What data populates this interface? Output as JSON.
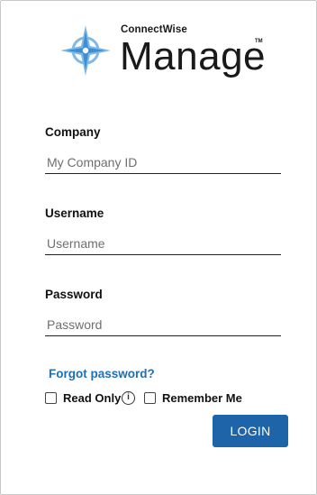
{
  "brand": {
    "company": "ConnectWise",
    "product": "Manage",
    "trademark": "TM",
    "colors": {
      "compass_light": "#7fb9e6",
      "compass_dark": "#3d8fd4"
    }
  },
  "form": {
    "company": {
      "label": "Company",
      "placeholder": "My Company ID"
    },
    "username": {
      "label": "Username",
      "placeholder": "Username"
    },
    "password": {
      "label": "Password",
      "placeholder": "Password"
    }
  },
  "links": {
    "forgot_password": "Forgot password?"
  },
  "options": {
    "read_only": "Read Only",
    "info_glyph": "i",
    "remember_me": "Remember Me"
  },
  "actions": {
    "login": "LOGIN"
  },
  "colors": {
    "link": "#1e6fb8",
    "button": "#1d64a8"
  }
}
